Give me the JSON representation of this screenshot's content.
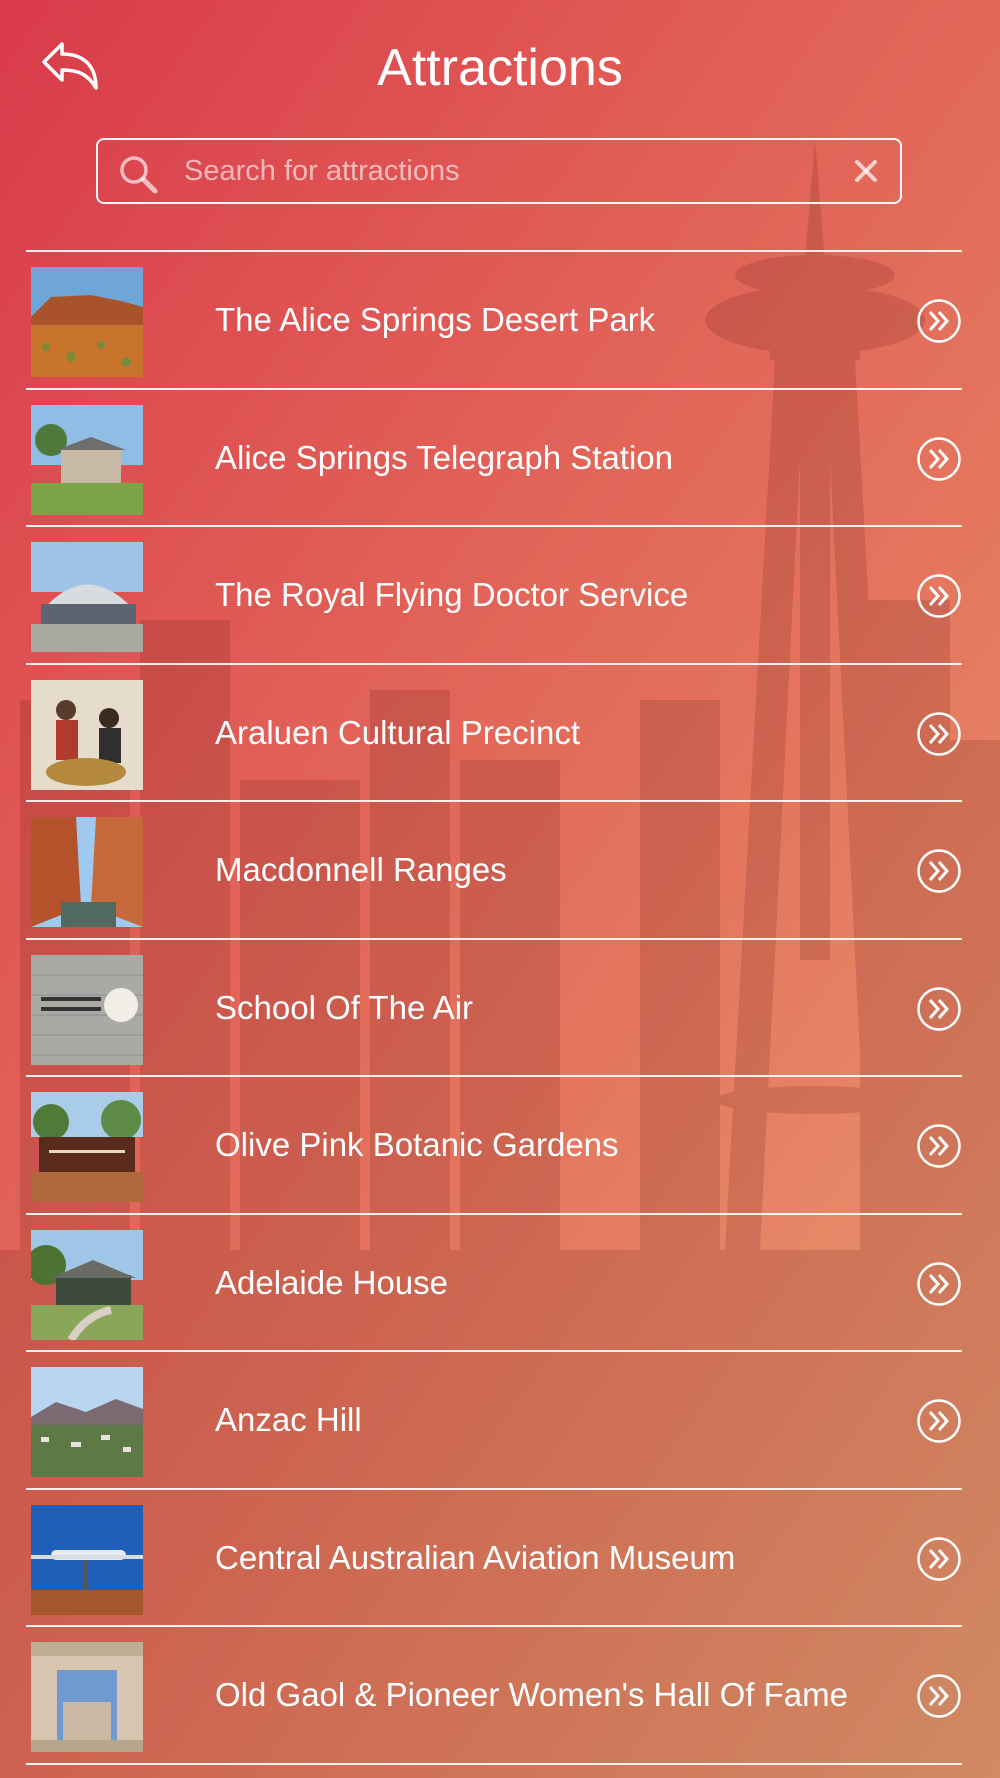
{
  "header": {
    "title": "Attractions",
    "back_icon": "reply-arrow-icon"
  },
  "search": {
    "placeholder": "Search for attractions",
    "value": "",
    "icon": "search-icon",
    "clear_icon": "close-icon"
  },
  "colors": {
    "gradient_start": "#d93a4a",
    "gradient_end": "#e9a274",
    "text": "#ffffff"
  },
  "attractions": [
    {
      "name": "The Alice Springs Desert Park",
      "thumb": "red-desert-landscape"
    },
    {
      "name": "Alice Springs Telegraph Station",
      "thumb": "stone-building-on-lawn"
    },
    {
      "name": "The Royal Flying Doctor Service",
      "thumb": "hangar-building"
    },
    {
      "name": "Araluen Cultural Precinct",
      "thumb": "people-with-baskets"
    },
    {
      "name": "Macdonnell Ranges",
      "thumb": "gorge-with-water"
    },
    {
      "name": "School Of The Air",
      "thumb": "sign-on-brick-wall"
    },
    {
      "name": "Olive Pink Botanic Gardens",
      "thumb": "garden-entrance-sign"
    },
    {
      "name": "Adelaide House",
      "thumb": "historic-house"
    },
    {
      "name": "Anzac Hill",
      "thumb": "town-view-with-hills"
    },
    {
      "name": "Central Australian Aviation Museum",
      "thumb": "plane-on-display"
    },
    {
      "name": "Old Gaol & Pioneer Women's Hall Of Fame",
      "thumb": "gaol-archway"
    }
  ]
}
